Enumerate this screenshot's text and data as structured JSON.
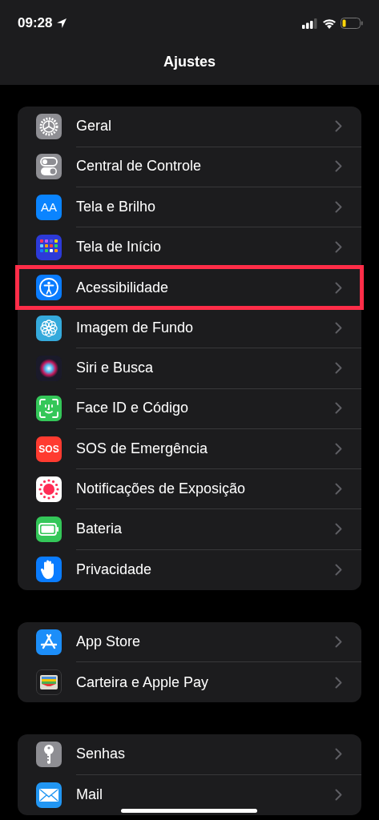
{
  "status_bar": {
    "time": "09:28"
  },
  "nav": {
    "title": "Ajustes"
  },
  "groups": [
    {
      "items": [
        {
          "label": "Geral",
          "kind": "gear",
          "highlighted": false
        },
        {
          "label": "Central de Controle",
          "kind": "toggles",
          "highlighted": false
        },
        {
          "label": "Tela e Brilho",
          "kind": "text-size",
          "icon_text": "AA",
          "highlighted": false
        },
        {
          "label": "Tela de Início",
          "kind": "home-grid",
          "highlighted": false
        },
        {
          "label": "Acessibilidade",
          "kind": "accessibility",
          "highlighted": true
        },
        {
          "label": "Imagem de Fundo",
          "kind": "flower",
          "highlighted": false
        },
        {
          "label": "Siri e Busca",
          "kind": "siri",
          "highlighted": false
        },
        {
          "label": "Face ID e Código",
          "kind": "face",
          "highlighted": false
        },
        {
          "label": "SOS de Emergência",
          "kind": "sos",
          "icon_text": "SOS",
          "highlighted": false
        },
        {
          "label": "Notificações de Exposição",
          "kind": "exposure",
          "highlighted": false
        },
        {
          "label": "Bateria",
          "kind": "battery",
          "highlighted": false
        },
        {
          "label": "Privacidade",
          "kind": "hand",
          "highlighted": false
        }
      ]
    },
    {
      "items": [
        {
          "label": "App Store",
          "kind": "app-store",
          "highlighted": false
        },
        {
          "label": "Carteira e Apple Pay",
          "kind": "wallet",
          "highlighted": false
        }
      ]
    },
    {
      "items": [
        {
          "label": "Senhas",
          "kind": "key",
          "highlighted": false
        },
        {
          "label": "Mail",
          "kind": "mail",
          "highlighted": false
        }
      ]
    }
  ]
}
